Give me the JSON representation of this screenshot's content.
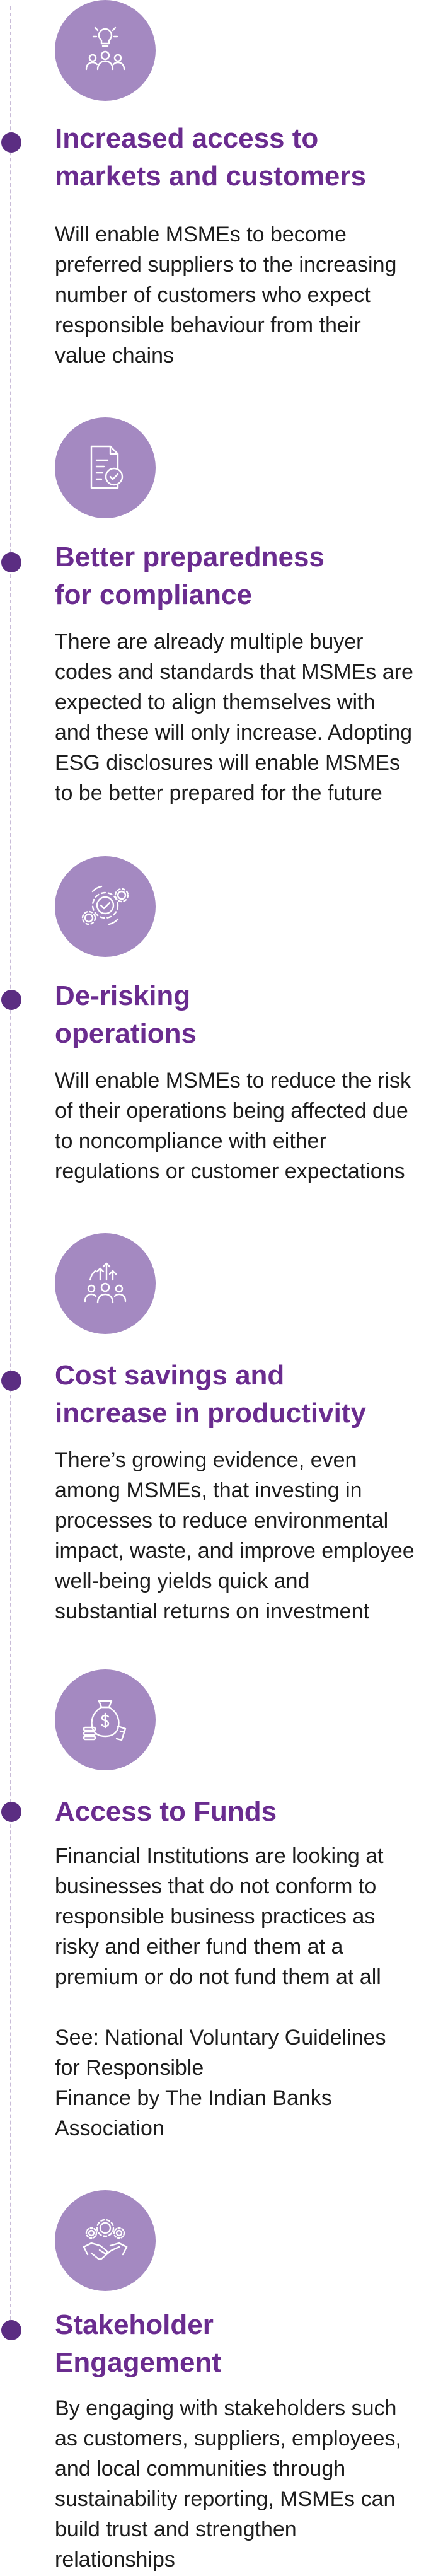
{
  "items": [
    {
      "icon": "idea-team-icon",
      "title": [
        "Increased access to",
        "markets and customers"
      ],
      "description": [
        "Will enable MSMEs to become",
        "preferred suppliers to the increasing",
        "number of customers who expect",
        "responsible behaviour from their",
        "value chains"
      ]
    },
    {
      "icon": "document-check-icon",
      "title": [
        "Better preparedness",
        "for compliance"
      ],
      "description": [
        "There are already multiple buyer",
        "codes and standards that MSMEs are",
        "expected to align themselves with",
        "and these will only increase. Adopting",
        "ESG disclosures will enable MSMEs",
        "to be better prepared for the future"
      ]
    },
    {
      "icon": "gears-check-icon",
      "title": [
        "De-risking",
        "operations"
      ],
      "description": [
        "Will enable MSMEs to reduce the risk",
        "of their operations being affected due",
        "to noncompliance with either",
        "regulations or customer expectations"
      ]
    },
    {
      "icon": "growth-team-icon",
      "title": [
        "Cost savings and",
        "increase in productivity"
      ],
      "description": [
        "There’s growing evidence, even",
        "among MSMEs, that investing in",
        "processes to reduce environmental",
        "impact, waste, and improve employee",
        "well-being yields quick and",
        "substantial returns on investment"
      ]
    },
    {
      "icon": "money-bag-icon",
      "title": [
        "Access to Funds"
      ],
      "description": [
        "Financial Institutions are looking at",
        "businesses that do not conform to",
        "responsible business practices as",
        "risky and either fund them at a",
        "premium or do not fund them at all"
      ],
      "note": [
        "See: National Voluntary Guidelines",
        "for Responsible",
        "Finance by The Indian Banks",
        "Association"
      ]
    },
    {
      "icon": "handshake-gears-icon",
      "title": [
        "Stakeholder",
        "Engagement"
      ],
      "description": [
        "By engaging with stakeholders such",
        "as customers, suppliers, employees,",
        "and local communities through",
        "sustainability reporting, MSMEs can",
        "build trust and strengthen",
        "relationships"
      ]
    }
  ]
}
